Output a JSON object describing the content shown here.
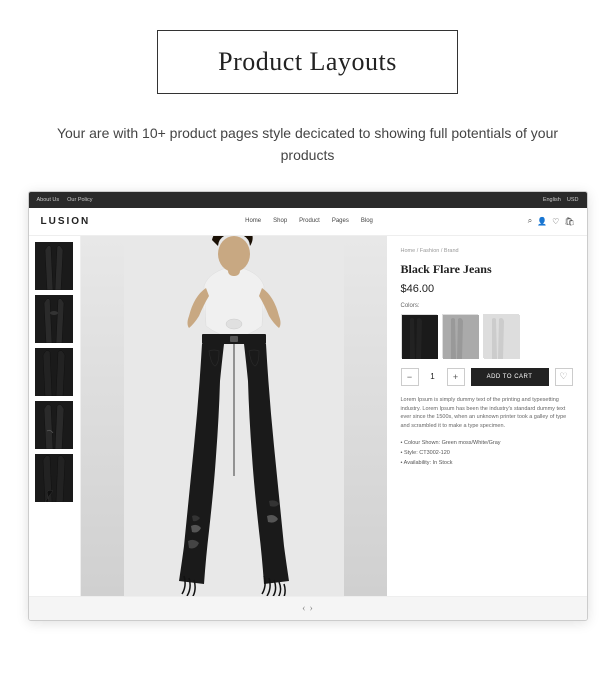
{
  "page": {
    "title": "Product Layouts",
    "subtitle": "Your are with 10+ product pages style decicated to showing full potentials of your products"
  },
  "topbar": {
    "left_items": [
      "About Us",
      "Our Policy"
    ],
    "right_items": [
      "English",
      "USD"
    ]
  },
  "nav": {
    "logo": "LUSION",
    "links": [
      "Home",
      "Shop",
      "Product",
      "Pages",
      "Blog"
    ]
  },
  "breadcrumb": "Home / Fashion / Brand",
  "product": {
    "name": "Black Flare Jeans",
    "price": "$46.00",
    "colors_label": "Colors:",
    "quantity": "1",
    "add_to_cart": "ADD TO CART",
    "description": "Lorem Ipsum is simply dummy text of the printing and typesetting industry. Lorem Ipsum has been the industry's standard dummy text ever since the 1500s, when an unknown printer took a galley of type and scrambled it to make a type specimen.",
    "meta": [
      "Colour Shown: Green moss/White/Gray",
      "Style: CT3002-120",
      "Availability: In Stock"
    ]
  }
}
